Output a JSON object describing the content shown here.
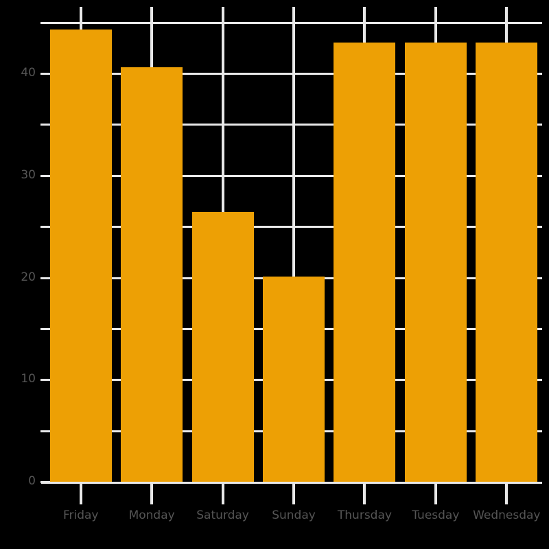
{
  "chart_data": {
    "type": "bar",
    "title": "",
    "subtitle": "",
    "xlabel": "",
    "ylabel": "",
    "categories": [
      "Friday",
      "Monday",
      "Saturday",
      "Sunday",
      "Thursday",
      "Tuesday",
      "Wednesday"
    ],
    "values": [
      44.3,
      40.6,
      26.4,
      20.1,
      43.0,
      43.0,
      43.0
    ],
    "ylim": [
      0,
      47.2
    ],
    "xlim": [
      0,
      7
    ],
    "y_ticks_major": [
      0,
      10,
      20,
      30,
      40
    ],
    "y_ticks_minor": [
      5,
      15,
      25,
      35,
      45
    ],
    "y_tick_labels": [
      "0",
      "10",
      "20",
      "30",
      "40"
    ],
    "grid": true,
    "grid_axis": "both",
    "legend": false,
    "legend_position": "none",
    "bar_color": "#eda005",
    "grid_color": "#e8e8e8",
    "background_color": "#000000",
    "tick_label_color": "#555555",
    "annotations": []
  },
  "axes": {
    "y_labels": [
      {
        "text": "0",
        "value": 0
      },
      {
        "text": "10",
        "value": 10
      },
      {
        "text": "20",
        "value": 20
      },
      {
        "text": "30",
        "value": 30
      },
      {
        "text": "40",
        "value": 40
      }
    ],
    "x_labels": [
      {
        "text": "Friday"
      },
      {
        "text": "Monday"
      },
      {
        "text": "Saturday"
      },
      {
        "text": "Sunday"
      },
      {
        "text": "Thursday"
      },
      {
        "text": "Tuesday"
      },
      {
        "text": "Wednesday"
      }
    ]
  }
}
